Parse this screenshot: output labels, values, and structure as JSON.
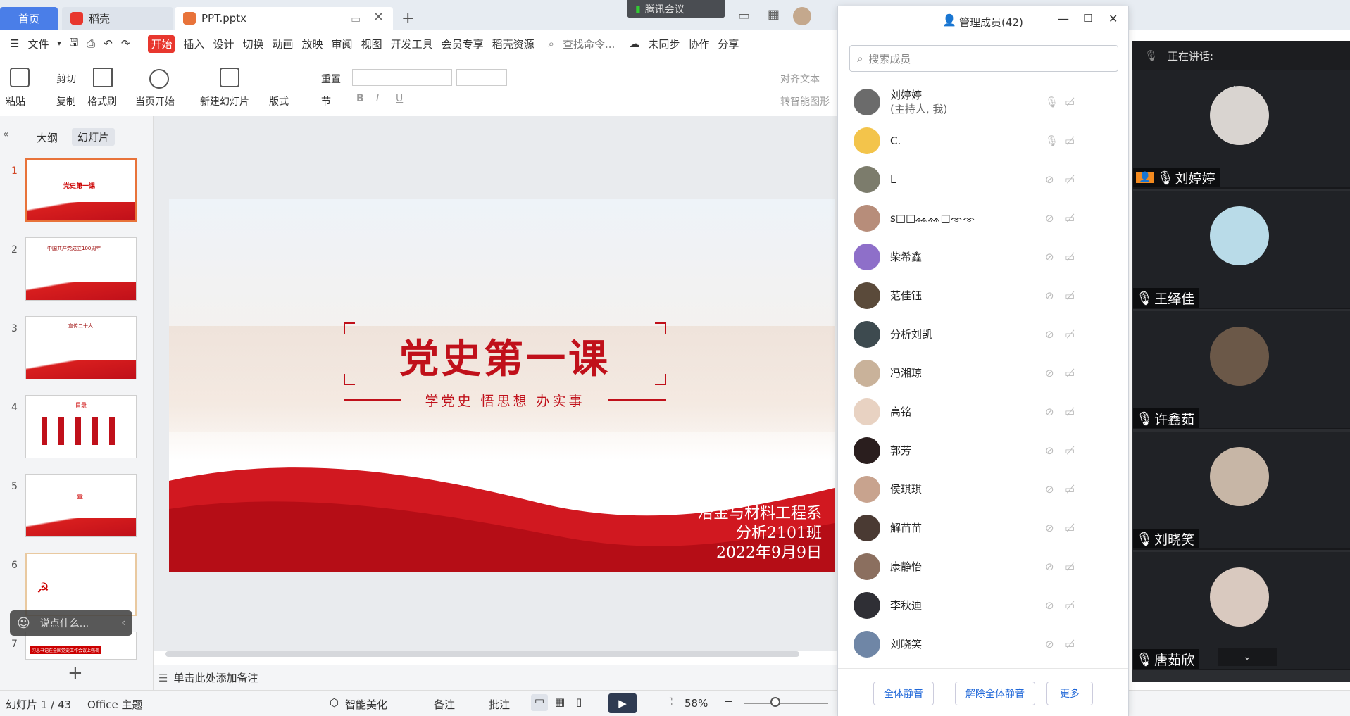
{
  "tabs": {
    "home": "首页",
    "daoke": "稻壳",
    "doc": "PPT.pptx",
    "meeting": "腾讯会议"
  },
  "menu": {
    "file": "文件",
    "items": [
      "开始",
      "插入",
      "设计",
      "切换",
      "动画",
      "放映",
      "审阅",
      "视图",
      "开发工具",
      "会员专享",
      "稻壳资源"
    ],
    "search": "查找命令...",
    "sync": "未同步",
    "collab": "协作",
    "share": "分享"
  },
  "ribbon": {
    "paste": "粘贴",
    "cut": "剪切",
    "copy": "复制",
    "format_painter": "格式刷",
    "play_from_current": "当页开始",
    "new_slide": "新建幻灯片",
    "layout": "版式",
    "reset": "重置",
    "section": "节",
    "align_text": "对齐文本",
    "smart_shape": "转智能图形"
  },
  "leftpane": {
    "outline": "大纲",
    "slides": "幻灯片",
    "comment_placeholder": "说点什么...",
    "thumbs": [
      {
        "n": "1",
        "title": "党史第一课"
      },
      {
        "n": "2",
        "title": "中国共产党成立100周年"
      },
      {
        "n": "3",
        "title": "宣传二十大"
      },
      {
        "n": "4",
        "title": "目录"
      },
      {
        "n": "5",
        "title": "壹"
      },
      {
        "n": "6",
        "title": ""
      },
      {
        "n": "7",
        "title": "习总书记在全国党史工作会议上强调"
      }
    ]
  },
  "slide": {
    "title": "党史第一课",
    "subtitle": "学党史 悟思想 办实事",
    "dept": "冶金与材料工程系",
    "class": "分析2101班",
    "date": "2022年9月9日"
  },
  "notes": "单击此处添加备注",
  "status": {
    "page": "幻灯片 1 / 43",
    "theme": "Office 主题",
    "beautify": "智能美化",
    "notes": "备注",
    "comment": "批注",
    "zoom": "58%"
  },
  "members": {
    "title": "管理成员(42)",
    "search_placeholder": "搜索成员",
    "list": [
      {
        "name": "刘婷婷",
        "sub": "(主持人, 我)",
        "color": "#6b6b6b"
      },
      {
        "name": "C.",
        "sub": "",
        "color": "#f3c44b"
      },
      {
        "name": "L",
        "sub": "",
        "color": "#7c7c6c"
      },
      {
        "name": "s□□ᨐᨐ□ᨎᨎ",
        "sub": "",
        "color": "#b78d7a"
      },
      {
        "name": "柴希鑫",
        "sub": "",
        "color": "#8e6fc9"
      },
      {
        "name": "范佳钰",
        "sub": "",
        "color": "#5a4a3a"
      },
      {
        "name": "分析刘凯",
        "sub": "",
        "color": "#3d4a4f"
      },
      {
        "name": "冯湘琼",
        "sub": "",
        "color": "#c9b29a"
      },
      {
        "name": "高铭",
        "sub": "",
        "color": "#e8d2c2"
      },
      {
        "name": "郭芳",
        "sub": "",
        "color": "#2a1e1e"
      },
      {
        "name": "侯琪琪",
        "sub": "",
        "color": "#c8a38e"
      },
      {
        "name": "解苗苗",
        "sub": "",
        "color": "#4a3a33"
      },
      {
        "name": "康静怡",
        "sub": "",
        "color": "#8b6f5f"
      },
      {
        "name": "李秋迪",
        "sub": "",
        "color": "#2f2f35"
      },
      {
        "name": "刘晓笑",
        "sub": "",
        "color": "#6f86a6"
      }
    ],
    "mute_all": "全体静音",
    "unmute_all": "解除全体静音",
    "more": "更多"
  },
  "video": {
    "speaking": "正在讲话:",
    "tiles": [
      {
        "name": "刘婷婷",
        "color": "#d9d4d0",
        "host": true
      },
      {
        "name": "王绎佳",
        "color": "#b9dbe8",
        "host": false
      },
      {
        "name": "许鑫茹",
        "color": "#6b5848",
        "host": false
      },
      {
        "name": "刘晓笑",
        "color": "#c7b6a6",
        "host": false
      },
      {
        "name": "唐茹欣",
        "color": "#d9c9bf",
        "host": false
      }
    ]
  }
}
